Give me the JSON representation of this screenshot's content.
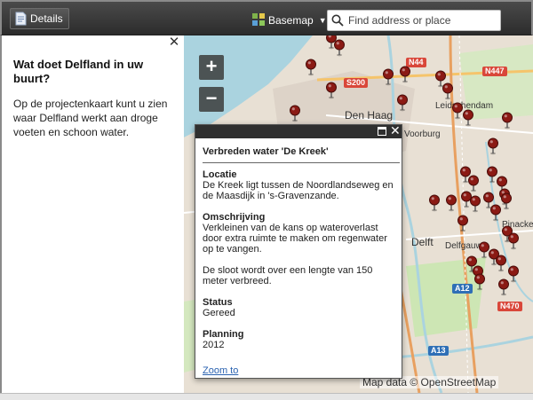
{
  "toolbar": {
    "details_label": "Details",
    "basemap_label": "Basemap",
    "search_placeholder": "Find address or place"
  },
  "sidepanel": {
    "title": "Wat doet Delfland in uw buurt?",
    "text": "Op de projectenkaart kunt u zien waar Delfland werkt aan droge voeten en schoon water."
  },
  "map": {
    "zoom_in": "+",
    "zoom_out": "−",
    "labels": {
      "den_haag": "Den Haag",
      "voorburg": "Voorburg",
      "leidschendam": "Leidschendam",
      "delft": "Delft",
      "pinacker": "Pinacke",
      "delfgauw": "Delfgauw"
    },
    "shields": {
      "n44": "N44",
      "s200": "S200",
      "n447": "N447",
      "a12": "A12",
      "a13": "A13",
      "n470": "N470"
    },
    "attribution": "Map data © OpenStreetMap"
  },
  "popup": {
    "title": "Verbreden water 'De Kreek'",
    "locatie_label": "Locatie",
    "locatie_text": "De Kreek ligt tussen de Noordlandseweg en de Maasdijk in 's-Gravenzande.",
    "omschrijving_label": "Omschrijving",
    "omschrijving_text1": "Verkleinen van de kans op wateroverlast door extra ruimte te maken om regenwater op te vangen.",
    "omschrijving_text2": "De sloot wordt over een lengte van 150 meter verbreed.",
    "status_label": "Status",
    "status_value": "Gereed",
    "planning_label": "Planning",
    "planning_value": "2012",
    "zoom_link": "Zoom to"
  },
  "colors": {
    "pin": "#8b1a14",
    "water": "#aad3df",
    "topbar": "#3a3a3a"
  }
}
